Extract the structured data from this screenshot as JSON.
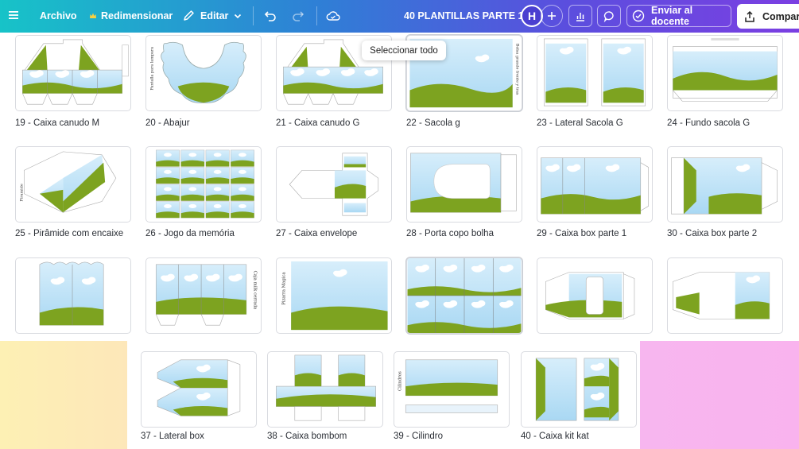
{
  "topbar": {
    "menu_icon": "hamburger-icon",
    "file_label": "Archivo",
    "resize_label": "Redimensionar",
    "edit_label": "Editar",
    "title": "40 PLANTILLAS PARTE 1",
    "avatar_initial": "H",
    "send_label": "Enviar al docente",
    "share_label": "Comparti"
  },
  "tooltip": "Seleccionar todo",
  "templates": [
    {
      "label": "19 - Caixa canudo M"
    },
    {
      "label": "20 - Abajur"
    },
    {
      "label": "21 - Caixa canudo G"
    },
    {
      "label": "22 - Sacola g"
    },
    {
      "label": "23 - Lateral Sacola G"
    },
    {
      "label": "24 - Fundo sacola G"
    },
    {
      "label": "25 - Pirâmide com encaixe"
    },
    {
      "label": "26 - Jogo da memória"
    },
    {
      "label": "27 - Caixa envelope"
    },
    {
      "label": "28 - Porta copo bolha"
    },
    {
      "label": "29 - Caixa box parte 1"
    },
    {
      "label": "30 - Caixa box parte 2"
    },
    {
      "label": ""
    },
    {
      "label": ""
    },
    {
      "label": ""
    },
    {
      "label": ""
    },
    {
      "label": ""
    },
    {
      "label": ""
    },
    {
      "label": "37 - Lateral box"
    },
    {
      "label": "38 - Caixa bombom"
    },
    {
      "label": "39 - Cilindro"
    },
    {
      "label": "40 - Caixa kit kat"
    }
  ],
  "thumb_texts": {
    "t20": "Pantalla para lampara",
    "t22": "Bolsa grande frente y tras",
    "t25": "Piramide",
    "t33": "Caja milk cerrada",
    "t34": "Pizarra Magica",
    "t39": "Cilindros"
  },
  "colors": {
    "sky": "#bfe3f7",
    "grass": "#7da320",
    "grass_dark": "#5f8a12"
  }
}
